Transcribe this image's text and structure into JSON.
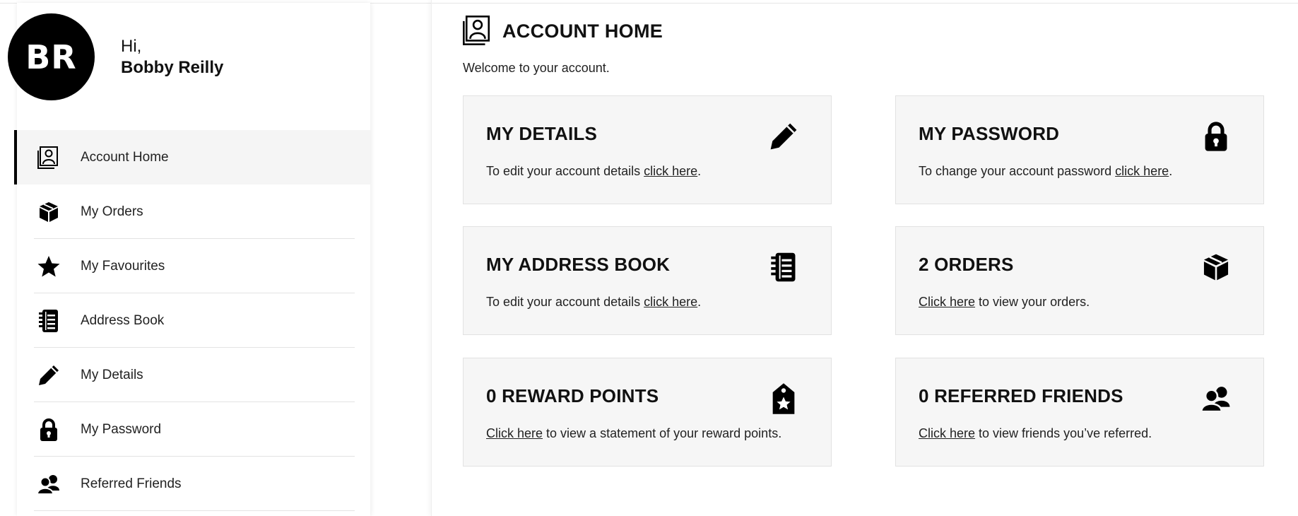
{
  "user": {
    "initials": "BR",
    "greeting": "Hi,",
    "name": "Bobby Reilly"
  },
  "sidebar": {
    "items": [
      {
        "label": "Account Home",
        "icon": "account-home-icon",
        "active": true
      },
      {
        "label": "My Orders",
        "icon": "box-icon"
      },
      {
        "label": "My Favourites",
        "icon": "star-icon"
      },
      {
        "label": "Address Book",
        "icon": "address-book-icon"
      },
      {
        "label": "My Details",
        "icon": "pencil-icon"
      },
      {
        "label": "My Password",
        "icon": "lock-icon"
      },
      {
        "label": "Referred Friends",
        "icon": "users-icon"
      }
    ]
  },
  "main": {
    "title": "ACCOUNT HOME",
    "welcome": "Welcome to your account.",
    "cards": [
      {
        "title": "MY DETAILS",
        "icon": "pencil-icon",
        "pre": "To edit your account details ",
        "link": "click here",
        "post": "."
      },
      {
        "title": "MY PASSWORD",
        "icon": "lock-icon",
        "pre": "To change your account password ",
        "link": "click here",
        "post": "."
      },
      {
        "title": "MY ADDRESS BOOK",
        "icon": "address-book-icon",
        "pre": "To edit your account details ",
        "link": "click here",
        "post": "."
      },
      {
        "title": "2 ORDERS",
        "icon": "box-icon",
        "pre": "",
        "link": "Click here",
        "post": " to view your orders."
      },
      {
        "title": "0 REWARD POINTS",
        "icon": "reward-tag-icon",
        "pre": "",
        "link": "Click here",
        "post": " to view a statement of your reward points."
      },
      {
        "title": "0 REFERRED FRIENDS",
        "icon": "users-icon",
        "pre": "",
        "link": "Click here",
        "post": " to view friends you’ve referred."
      }
    ]
  },
  "colors": {
    "accent": "#000000",
    "card_bg": "#f6f6f6",
    "active_bg": "#f5f5f5"
  }
}
